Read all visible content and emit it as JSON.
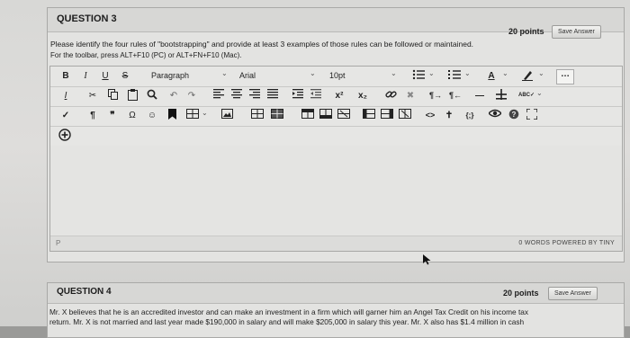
{
  "question3": {
    "title": "QUESTION 3",
    "points": "20 points",
    "save_label": "Save Answer",
    "prompt": "Please identify the four rules of \"bootstrapping\" and provide at least 3 examples of those rules can be followed or maintained.",
    "toolbar_hint": "For the toolbar, press ALT+F10 (PC) or ALT+FN+F10 (Mac)."
  },
  "editor": {
    "bold": "B",
    "italic": "I",
    "underline": "U",
    "strike": "S",
    "format_select": "Paragraph",
    "font_select": "Arial",
    "size_select": "10pt",
    "superscript": "x²",
    "subscript": "x₂",
    "omega": "Ω",
    "paragraph_mark": "¶",
    "quote_mark": "❞",
    "code_view": "<>",
    "status_tag": "P",
    "word_count": "0 WORDS  POWERED BY TINY"
  },
  "question4": {
    "title": "QUESTION 4",
    "points": "20 points",
    "save_label": "Save Answer",
    "body_line1": "Mr. X believes that he is an accredited investor and can make an investment in a firm which will garner him an Angel Tax Credit on his income tax",
    "body_line2": "return.  Mr. X is not married and last year made $190,000 in salary and will make $205,000 in salary this year.  Mr. X also has $1.4 million in cash"
  },
  "colors": {
    "link_icon": "#3a3a3a",
    "dark_icon": "#111111"
  }
}
